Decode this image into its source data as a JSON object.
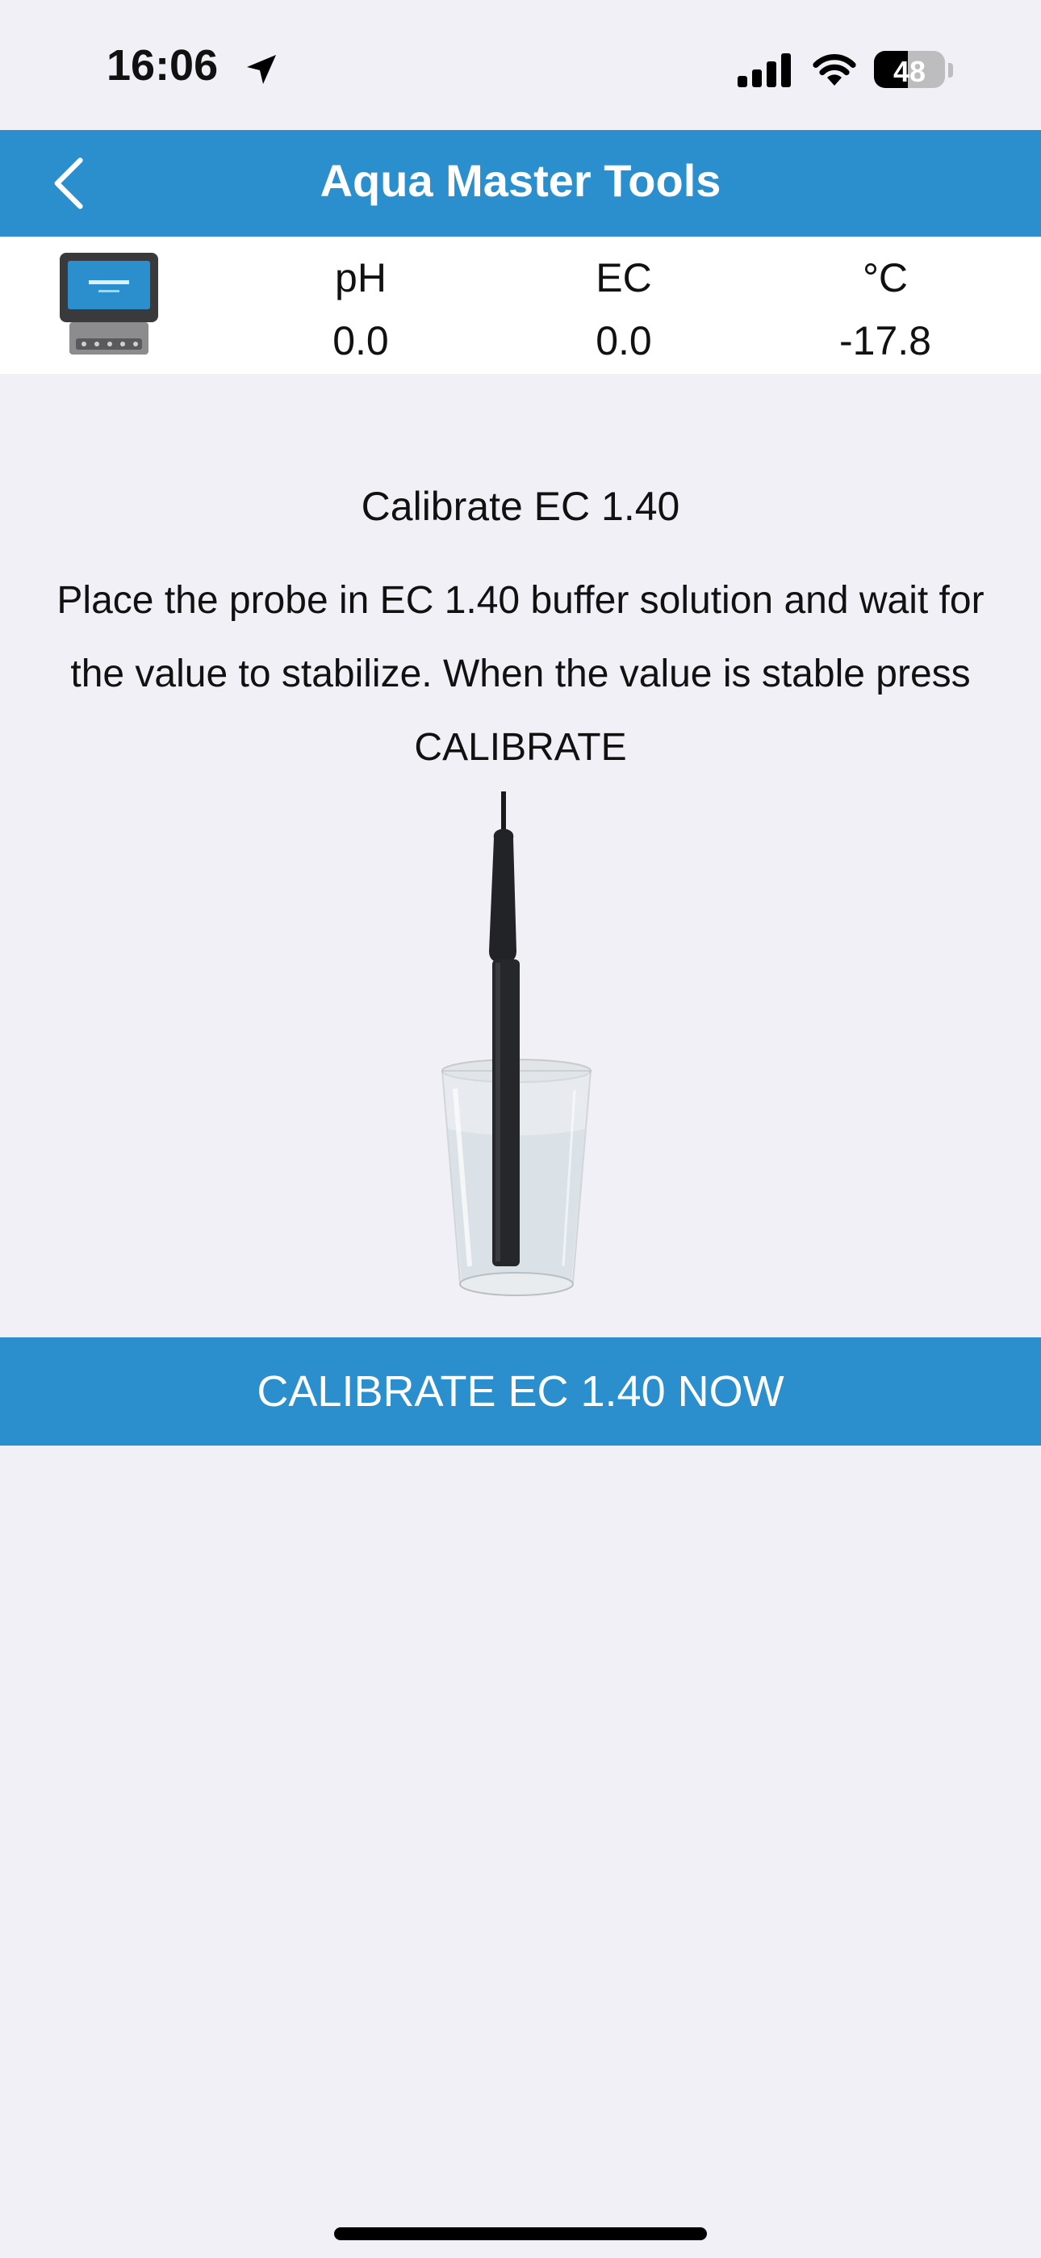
{
  "status_bar": {
    "time": "16:06",
    "battery_level": "48",
    "battery_fraction": 0.48,
    "icons": [
      "location-arrow-icon",
      "cellular-signal-icon",
      "wifi-icon",
      "battery-icon"
    ]
  },
  "nav": {
    "title": "Aqua Master Tools",
    "back_icon": "chevron-left-icon"
  },
  "readings": [
    {
      "label": "pH",
      "value": "0.0"
    },
    {
      "label": "EC",
      "value": "0.0"
    },
    {
      "label": "°C",
      "value": "-17.8"
    }
  ],
  "content": {
    "title": "Calibrate EC 1.40",
    "instructions": "Place the probe in EC 1.40 buffer solution and wait for the value to stabilize. When the value is stable press CALIBRATE"
  },
  "calibrate_button_label": "CALIBRATE EC 1.40 NOW",
  "colors": {
    "accent": "#2a8fcc",
    "background": "#f1f0f6",
    "header_text": "#ffffff"
  }
}
